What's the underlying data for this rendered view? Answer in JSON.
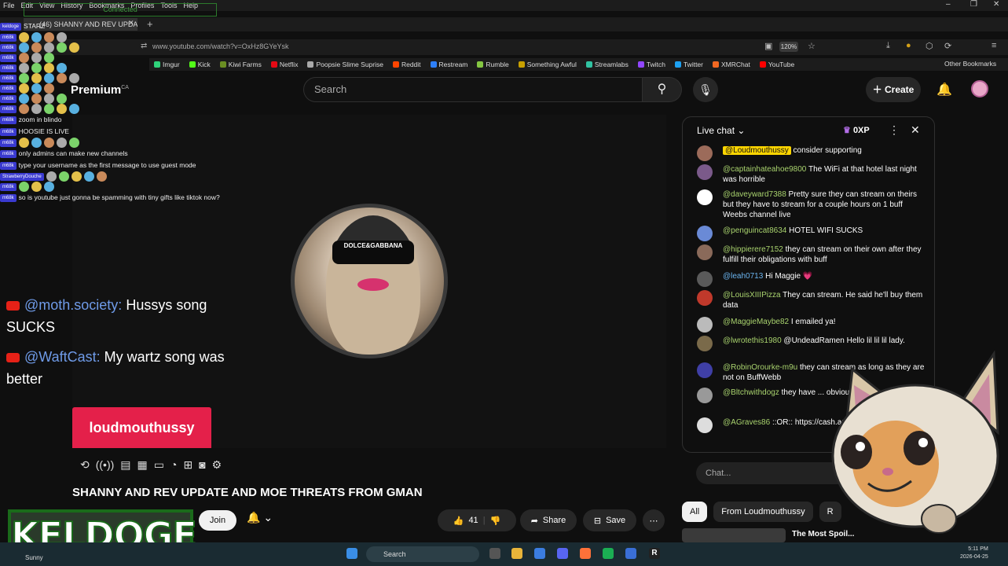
{
  "browser": {
    "menu": [
      "File",
      "Edit",
      "View",
      "History",
      "Bookmarks",
      "Profiles",
      "Tools",
      "Help"
    ],
    "connected": "Connected",
    "tab_title": "(46) SHANNY AND REV UPDATE",
    "url": "www.youtube.com/watch?v=OxHz8GYeYsk",
    "zoom": "120%",
    "bookmarks": [
      {
        "label": "Imgur",
        "color": "#2fd27a"
      },
      {
        "label": "Kick",
        "color": "#53fc18"
      },
      {
        "label": "Kiwi Farms",
        "color": "#6b8e23"
      },
      {
        "label": "Netflix",
        "color": "#e50914"
      },
      {
        "label": "Poopsie Slime Suprise",
        "color": "#aaaaaa"
      },
      {
        "label": "Reddit",
        "color": "#ff4500"
      },
      {
        "label": "Restream",
        "color": "#2d7ff9"
      },
      {
        "label": "Rumble",
        "color": "#85c742"
      },
      {
        "label": "Something Awful",
        "color": "#c8a000"
      },
      {
        "label": "Streamlabs",
        "color": "#31c3a2"
      },
      {
        "label": "Twitch",
        "color": "#9146ff"
      },
      {
        "label": "Twitter",
        "color": "#1da1f2"
      },
      {
        "label": "XMRChat",
        "color": "#f26822"
      },
      {
        "label": "YouTube",
        "color": "#ff0000"
      }
    ],
    "other_bookmarks": "Other Bookmarks"
  },
  "youtube": {
    "logo": "Premium",
    "logo_region": "CA",
    "search_placeholder": "Search",
    "create_label": "Create"
  },
  "overlay_chat": [
    {
      "user": "keldoge",
      "text": "STARZ"
    },
    {
      "user": "m68k",
      "text": ""
    },
    {
      "user": "m68k",
      "text": ""
    },
    {
      "user": "m68k",
      "text": ""
    },
    {
      "user": "m68k",
      "text": ""
    },
    {
      "user": "m68k",
      "text": ""
    },
    {
      "user": "m68k",
      "text": ""
    },
    {
      "user": "m68k",
      "text": ""
    },
    {
      "user": "m68k",
      "text": ""
    },
    {
      "user": "m68k",
      "text": "zoom in blindo"
    },
    {
      "user": "m68k",
      "text": "HOOSIE IS LIVE"
    },
    {
      "user": "m68k",
      "text": ""
    },
    {
      "user": "m68k",
      "text": "only admins can make new channels"
    },
    {
      "user": "m68k",
      "text": "type your username as the first message to use guest mode"
    },
    {
      "user": "StrawberryDouche",
      "text": ""
    },
    {
      "user": "m68k",
      "text": ""
    },
    {
      "user": "m68k",
      "text": "so is youtube just gonna be spamming with tiny gifts like tiktok now?"
    }
  ],
  "big_chat": [
    {
      "user": "@moth.society:",
      "text": " Hussys song SUCKS"
    },
    {
      "user": "@WaftCast:",
      "text": " My wartz song was better"
    }
  ],
  "video": {
    "name_banner": "loudmouthussy",
    "glasses_text": "DOLCE&GABBANA",
    "title": "SHANNY AND REV UPDATE AND MOE THREATS FROM GMAN",
    "join": "Join",
    "likes": "41",
    "share": "Share",
    "save": "Save"
  },
  "live_chat": {
    "header": "Live chat",
    "points": "0XP",
    "input_placeholder": "Chat...",
    "messages": [
      {
        "author": "@Loudmouthussy",
        "text": "consider supporting",
        "owner": true,
        "color": "#9c6b5a"
      },
      {
        "author": "@captainhateahoe9800",
        "text": "The WiFi at that hotel last night was horrible",
        "color": "#7b5a8a"
      },
      {
        "author": "@daveyward7388",
        "text": "Pretty sure they can stream on theirs but they have to stream for a couple hours on 1 buff Weebs channel live",
        "color": "#ffffff"
      },
      {
        "author": "@penguincat8634",
        "text": "HOTEL WIFI SUCKS",
        "color": "#6a8ad6"
      },
      {
        "author": "@hippierere7152",
        "text": "they can stream on their own after they fulfill their obligations with buff",
        "color": "#8a6a5a"
      },
      {
        "author": "@leah0713",
        "text": "Hi Maggie 💗",
        "color": "#5a5a5a",
        "blue": true
      },
      {
        "author": "@LouisXIIIPizza",
        "text": "They can stream. He said he'll buy them data",
        "color": "#c0392b"
      },
      {
        "author": "@MaggieMaybe82",
        "text": "I emailed ya!",
        "color": "#bbbbbb"
      },
      {
        "author": "@lwrotethis1980",
        "text": "@UndeadRamen Hello lil lil lil lady.",
        "color": "#7a6a4a"
      },
      {
        "author": "@RobinOrourke-m9u",
        "text": "they can stream as long as they are not on BuffWebb",
        "color": "#3f3fa6"
      },
      {
        "author": "@Bltchwithdogz",
        "text": "they have ... obviously cant use it while ...",
        "color": "#999999"
      },
      {
        "author": "@AGraves86",
        "text": "::OR:: https://cash.app/$lus...",
        "color": "#dddddd"
      }
    ],
    "chips": [
      "All",
      "From Loudmouthussy",
      "R"
    ],
    "related_title": "The Most Spoil..."
  },
  "stream_brand": "KELDOGE",
  "taskbar": {
    "search": "Search",
    "weather": "Sunny",
    "time": "5:11 PM",
    "date": "2026-04-25"
  }
}
